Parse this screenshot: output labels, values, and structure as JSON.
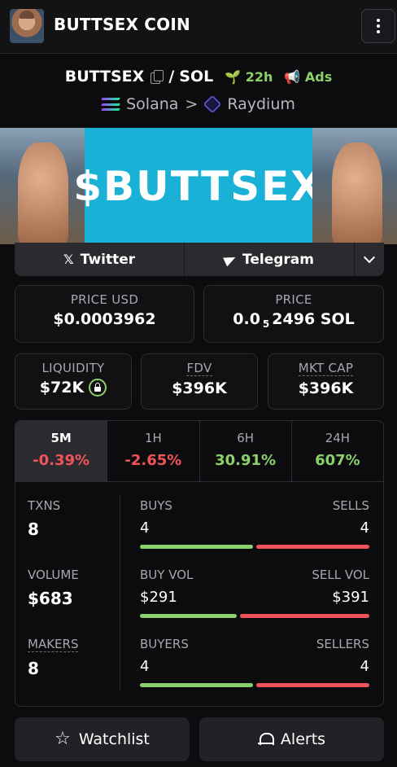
{
  "header": {
    "title": "BUTTSEX COIN"
  },
  "pair": {
    "base": "BUTTSEX",
    "separator": "/",
    "quote": "SOL",
    "age": "22h",
    "ads_label": "Ads"
  },
  "chain": {
    "network": "Solana",
    "separator": ">",
    "dex": "Raydium"
  },
  "banner": {
    "text": "$BUTTSEX"
  },
  "social": {
    "twitter_label": "Twitter",
    "telegram_label": "Telegram",
    "x_glyph": "𝕏"
  },
  "price": {
    "usd_label": "PRICE USD",
    "usd_value": "$0.0003962",
    "native_label": "PRICE",
    "native_prefix": "0.0",
    "native_zeros": "5",
    "native_digits": "2496",
    "native_unit": "SOL"
  },
  "metrics": {
    "liquidity_label": "LIQUIDITY",
    "liquidity_value": "$72K",
    "fdv_label": "FDV",
    "fdv_value": "$396K",
    "mktcap_label": "MKT CAP",
    "mktcap_value": "$396K"
  },
  "tabs": [
    {
      "label": "5M",
      "change": "-0.39%"
    },
    {
      "label": "1H",
      "change": "-2.65%"
    },
    {
      "label": "6H",
      "change": "30.91%"
    },
    {
      "label": "24H",
      "change": "607%"
    }
  ],
  "stats": {
    "txns": {
      "label": "TXNS",
      "value": "8",
      "left_label": "BUYS",
      "right_label": "SELLS",
      "left_value": "4",
      "right_value": "4",
      "left_share": 0.5
    },
    "volume": {
      "label": "VOLUME",
      "value": "$683",
      "left_label": "BUY VOL",
      "right_label": "SELL VOL",
      "left_value": "$291",
      "right_value": "$391",
      "left_share": 0.43
    },
    "makers": {
      "label": "MAKERS",
      "value": "8",
      "left_label": "BUYERS",
      "right_label": "SELLERS",
      "left_value": "4",
      "right_value": "4",
      "left_share": 0.5
    }
  },
  "actions": {
    "watchlist_label": "Watchlist",
    "alerts_label": "Alerts"
  },
  "colors": {
    "positive": "#8bd16b",
    "negative": "#f0545a",
    "banner": "#19b1d6"
  }
}
